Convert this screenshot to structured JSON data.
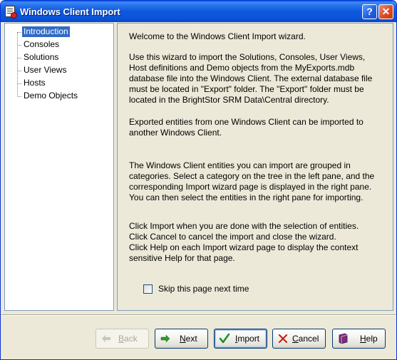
{
  "window": {
    "title": "Windows Client Import",
    "help_glyph": "?",
    "close_glyph": "✕"
  },
  "tree": {
    "items": [
      {
        "label": "Introduction",
        "selected": true
      },
      {
        "label": "Consoles"
      },
      {
        "label": "Solutions"
      },
      {
        "label": "User Views"
      },
      {
        "label": "Hosts"
      },
      {
        "label": "Demo Objects"
      }
    ]
  },
  "content": {
    "welcome": "Welcome to the Windows Client Import wizard.",
    "p1_l1": "Use this wizard to import the Solutions, Consoles, User Views,",
    "p1_l2": "Host definitions and Demo objects from the MyExports.mdb",
    "p1_l3": "database file into the Windows Client. The external database file",
    "p1_l4": "must be located in \"Export\" folder. The \"Export\" folder must be",
    "p1_l5": "located in the BrightStor SRM Data\\Central directory.",
    "p2_l1": "Exported entities from one Windows Client can be imported to",
    "p2_l2": "another Windows Client.",
    "p3_l1": "The Windows Client entities you can import are grouped in",
    "p3_l2": "categories. Select a category on the tree in the left pane, and the",
    "p3_l3": "corresponding Import wizard page is displayed in the right pane.",
    "p3_l4": "You can then select the entities in the right pane for importing.",
    "p4_l1": "Click Import when you are done with the selection of entities.",
    "p4_l2": "Click Cancel to cancel the import and close the wizard.",
    "p4_l3": "Click Help on each Import wizard page to display the context",
    "p4_l4": "sensitive Help for that page.",
    "skip_label": "Skip this page next time",
    "skip_checked": false
  },
  "buttons": {
    "back": "Back",
    "next": "Next",
    "import": "Import",
    "cancel": "Cancel",
    "help": "Help"
  },
  "icons": {
    "back": "arrow-left-icon",
    "next": "arrow-right-icon",
    "import": "checkmark-icon",
    "cancel": "x-mark-icon",
    "help": "book-icon"
  },
  "colors": {
    "titlebar": "#0a54d8",
    "selection": "#316ac5",
    "dialog_bg": "#ece9d8",
    "next_arrow": "#2e9a2e",
    "cancel_x": "#c8221a",
    "help_book": "#7b2a8c"
  }
}
